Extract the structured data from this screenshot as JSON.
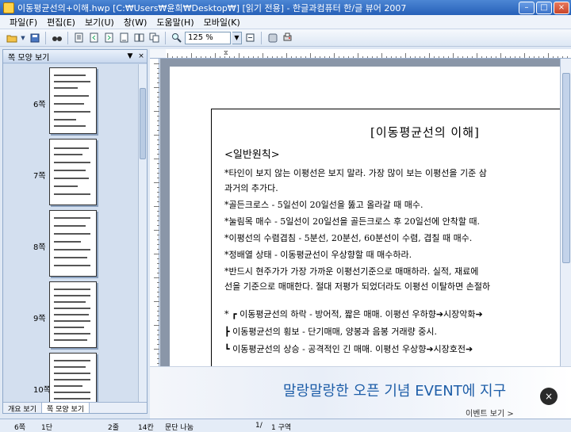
{
  "window": {
    "title": "이동평균선의+이해.hwp [C:₩Users₩윤희₩Desktop₩] [읽기 전용] - 한글과컴퓨터 한/글 뷰어 2007",
    "min_label": "–",
    "max_label": "□",
    "close_label": "×"
  },
  "menu": {
    "items": [
      "파일(F)",
      "편집(E)",
      "보기(U)",
      "창(W)",
      "도움말(H)",
      "모바일(K)"
    ]
  },
  "toolbar": {
    "zoom_value": "125 %",
    "zoom_dropdown_glyph": "▼"
  },
  "left_panel": {
    "title": "쪽 모양 보기",
    "pages": [
      {
        "label": "6쪽"
      },
      {
        "label": "7쪽"
      },
      {
        "label": "8쪽"
      },
      {
        "label": "9쪽"
      },
      {
        "label": "10쪽"
      }
    ],
    "tab_outline": "개요 보기",
    "tab_pages": "쪽 모양 보기"
  },
  "document": {
    "title": "[이동평균선의 이해]",
    "subtitle": "<일반원칙>",
    "lines": [
      "*타인이 보지 않는 이평선은 보지 말라. 가장 많이 보는 이평선을 기준 삼",
      "과거의 추가다.",
      "*골든크로스 - 5일선이 20일선을 뚫고 올라갈 때 매수.",
      "*눌림목 매수 - 5일선이 20일선을 골든크로스 후 20일선에 안착할 때.",
      "*이평선의 수렴겹침 - 5분선, 20분선, 60분선이 수렴, 겹칠 때 매수.",
      "*정배열 상태 - 이동평균선이 우상향할 때 매수하라.",
      "*반드시 현주가가 가장 가까운 이평선기준으로 매매하라. 실적, 재료에",
      "선을 기준으로 매매한다. 절대 저평가 되었더라도 이평선 이탈하면 손절하",
      "* ┏ 이동평균선의 하락 - 방어적, 짧은 매매.  이평선 우하향➔시장악화➔",
      "   ┣ 이동평균선의 횡보 - 단기매매, 양봉과 음봉 거래량 중시.",
      "   ┗ 이동평균선의 상승 - 공격적인 긴 매매.  이평선 우상향➔시장호전➔"
    ]
  },
  "banner": {
    "text": "말랑말랑한 오픈 기념 EVENT에 지구",
    "link": "이벤트 보기 >",
    "close_glyph": "×"
  },
  "statusbar": {
    "page": "6쪽",
    "section": "1단",
    "line": "2줄",
    "column": "14칸",
    "mode": "문단 나눔",
    "page_range": "1/",
    "area": "1 구역"
  }
}
